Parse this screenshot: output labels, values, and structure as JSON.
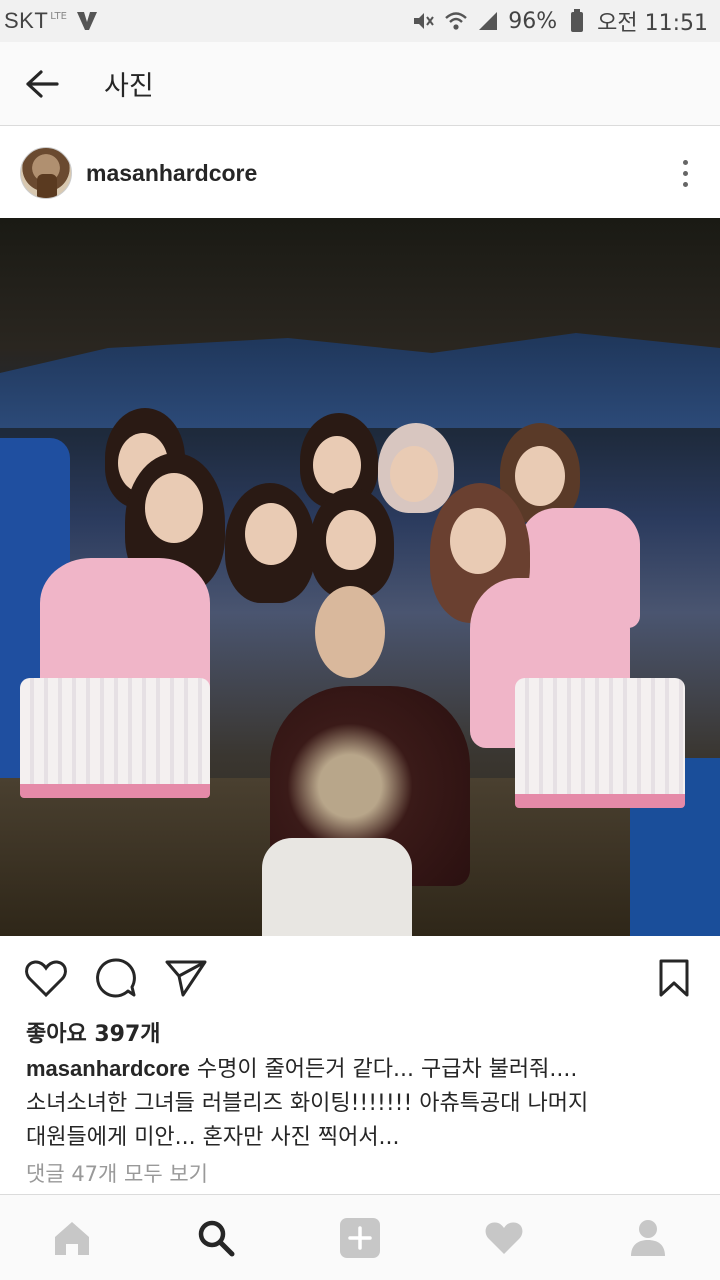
{
  "status_bar": {
    "carrier": "SKT",
    "network": "LTE",
    "battery": "96%",
    "time": "오전 11:51"
  },
  "header": {
    "title": "사진"
  },
  "post": {
    "username": "masanhardcore",
    "likes": "좋아요 397개",
    "caption_user": "masanhardcore",
    "caption_line1": " 수명이 줄어든거 같다... 구급차 불러줘....",
    "caption_line2": "소녀소녀한 그녀들 러블리즈 화이팅!!!!!!! 아츄특공대 나머지",
    "caption_line3": "대원들에게 미안... 혼자만 사진 찍어서...",
    "comments_link": "댓글 47개 모두 보기"
  },
  "icons": {
    "back": "arrow-left-icon",
    "more": "more-vertical-icon",
    "like": "heart-outline-icon",
    "comment": "comment-bubble-icon",
    "share": "paper-plane-icon",
    "save": "bookmark-icon",
    "nav_home": "home-icon",
    "nav_search": "search-icon",
    "nav_add": "plus-square-icon",
    "nav_activity": "heart-icon",
    "nav_profile": "profile-icon"
  },
  "colors": {
    "text": "#262626",
    "muted": "#999999",
    "nav_inactive": "#c7c7c7",
    "nav_active": "#262626"
  }
}
